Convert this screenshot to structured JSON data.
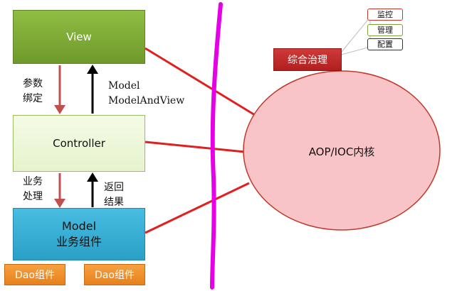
{
  "diagram": {
    "view": {
      "label": "View"
    },
    "controller": {
      "label": "Controller"
    },
    "model": {
      "line1": "Model",
      "line2": "业务组件"
    },
    "dao": [
      "Dao组件",
      "Dao组件"
    ],
    "edges": {
      "param_binding": [
        "参数",
        "绑定"
      ],
      "model_and_view": [
        "Model",
        "ModelAndView"
      ],
      "business_processing": [
        "业务",
        "处理"
      ],
      "return_result": [
        "返回",
        "结果"
      ]
    },
    "core": {
      "label": "AOP/IOC内核"
    },
    "governance": {
      "label": "综合治理",
      "tags": [
        "监控",
        "管理",
        "配置"
      ]
    },
    "colors": {
      "view": "#7fae37",
      "controller": "#eef8dc",
      "model": "#36b0d8",
      "dao": "#ef8f2c",
      "core_fill": "#f9c4c8",
      "core_stroke": "#c0392b",
      "link_line": "#e02020",
      "down_arrow": "#c0504d",
      "up_arrow": "#000000",
      "divider": "#e600e6",
      "governance": "#c0282a"
    }
  }
}
